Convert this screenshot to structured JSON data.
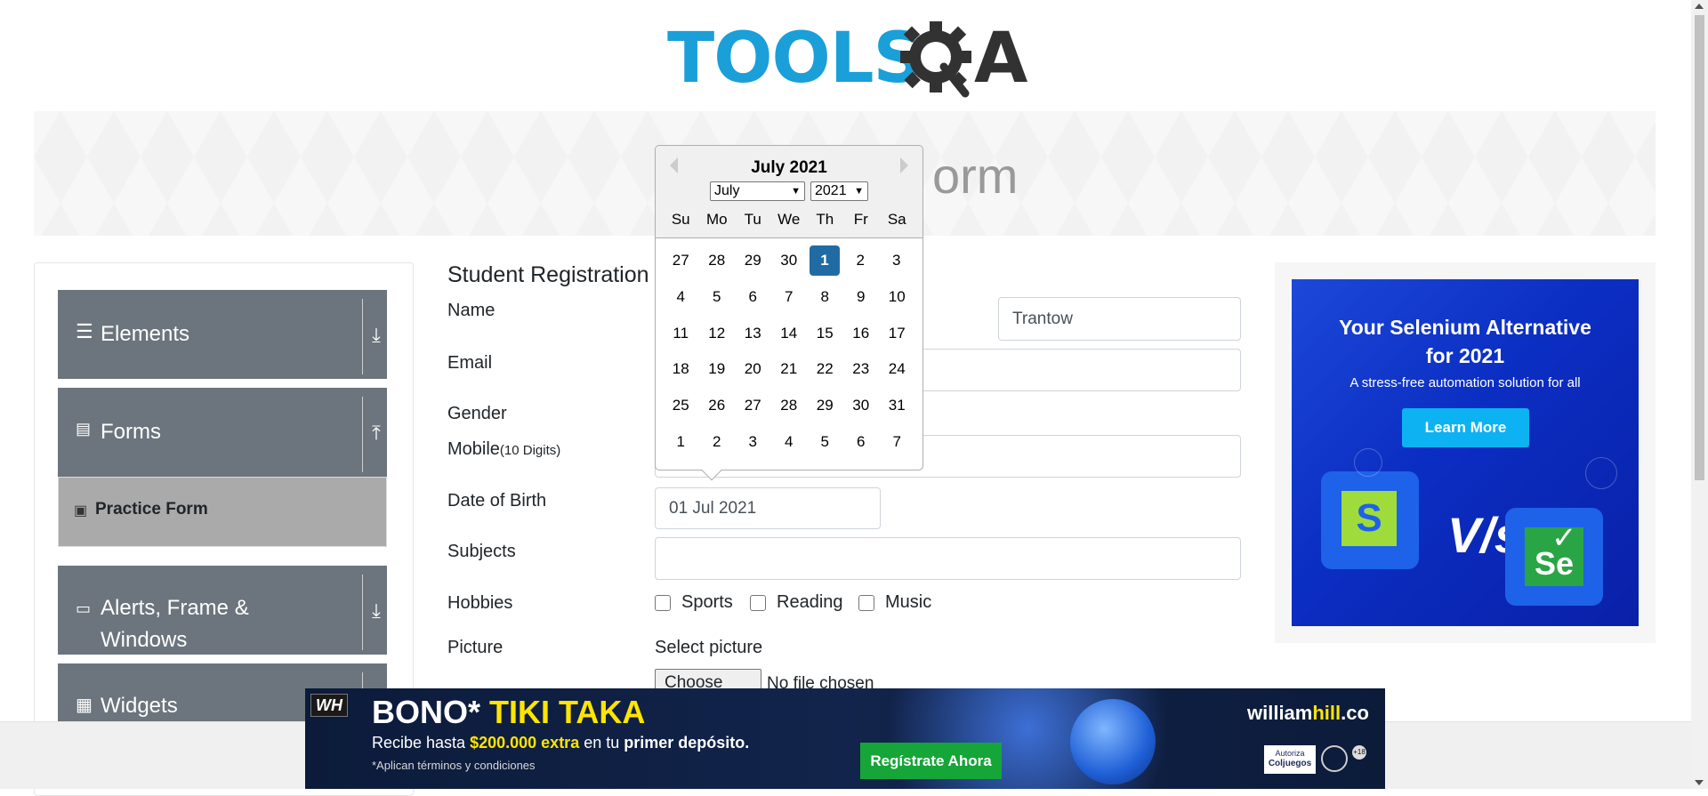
{
  "logo": {
    "part1": "TOOLS",
    "part2": "A"
  },
  "banner": {
    "title": "Practice Form",
    "visible_fragment": "orm"
  },
  "sidebar": {
    "groups": [
      {
        "label": "Elements",
        "icon": "hamburger-icon",
        "arrow": "download-icon"
      },
      {
        "label": "Forms",
        "icon": "document-icon",
        "arrow": "upload-icon"
      },
      {
        "label": "Alerts, Frame & Windows",
        "icon": "window-icon",
        "arrow": "download-icon"
      },
      {
        "label": "Widgets",
        "icon": "widgets-icon",
        "arrow": "download-icon"
      }
    ],
    "active_item": {
      "label": "Practice Form",
      "icon": "form-icon"
    }
  },
  "form": {
    "heading": "Student Registration",
    "labels": {
      "name": "Name",
      "email": "Email",
      "gender": "Gender",
      "mobile": "Mobile",
      "mobile_hint": "(10 Digits)",
      "dob": "Date of Birth",
      "subjects": "Subjects",
      "hobbies": "Hobbies",
      "picture": "Picture"
    },
    "last_name_value": "Trantow",
    "dob_value": "01 Jul 2021",
    "hobbies": [
      "Sports",
      "Reading",
      "Music"
    ],
    "picture": {
      "select_label": "Select picture",
      "button": "Choose File",
      "status": "No file chosen"
    }
  },
  "datepicker": {
    "title": "July 2021",
    "month_select": "July",
    "year_select": "2021",
    "weekdays": [
      "Su",
      "Mo",
      "Tu",
      "We",
      "Th",
      "Fr",
      "Sa"
    ],
    "weeks": [
      [
        "27",
        "28",
        "29",
        "30",
        "1",
        "2",
        "3"
      ],
      [
        "4",
        "5",
        "6",
        "7",
        "8",
        "9",
        "10"
      ],
      [
        "11",
        "12",
        "13",
        "14",
        "15",
        "16",
        "17"
      ],
      [
        "18",
        "19",
        "20",
        "21",
        "22",
        "23",
        "24"
      ],
      [
        "25",
        "26",
        "27",
        "28",
        "29",
        "30",
        "31"
      ],
      [
        "1",
        "2",
        "3",
        "4",
        "5",
        "6",
        "7"
      ]
    ],
    "selected_day": "1"
  },
  "ad_right": {
    "headline_line1": "Your Selenium Alternative",
    "headline_line2": "for 2021",
    "subtitle": "A stress-free automation solution for all",
    "cta": "Learn More",
    "vs": "V/s",
    "logo_left": "S",
    "logo_right": "Se"
  },
  "ad_bottom": {
    "logo": "WH",
    "title_white": "BONO*",
    "title_yellow": "TIKI TAKA",
    "line_pre": "Recibe hasta",
    "line_amount": "$200.000 extra",
    "line_mid": "en tu",
    "line_bold": "primer depósito.",
    "terms": "*Aplican términos y condiciones",
    "cta": "Regístrate Ahora",
    "brand_white": "william",
    "brand_yellow": "hill",
    "brand_suffix": ".co",
    "badge_top": "Autoriza",
    "badge_main": "Coljuegos",
    "age": "+18"
  },
  "colors": {
    "logo_blue": "#1a9fd9",
    "logo_dark": "#323232",
    "sidebar_group": "#6c757d",
    "sidebar_active": "#aaaaaa",
    "datepicker_selected": "#216ba5",
    "ad_blue": "#0b2ec2",
    "ad_cta": "#0db2f2",
    "bottom_cta": "#16a538",
    "bottom_yellow": "#ffe500"
  }
}
